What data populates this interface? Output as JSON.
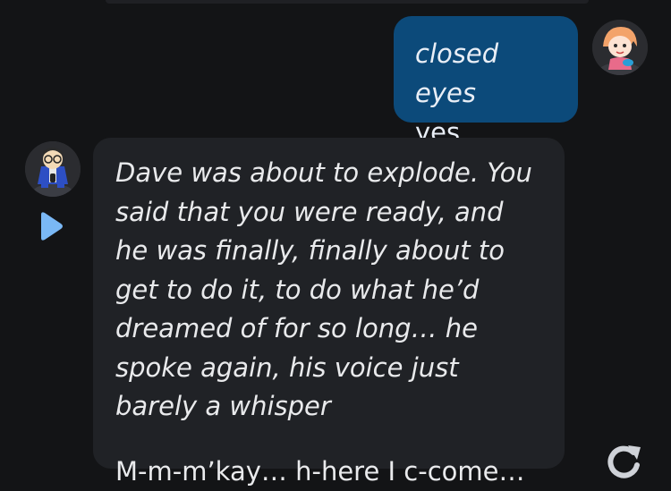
{
  "chat": {
    "user_message": {
      "line1": "closed eyes",
      "line2": "yes"
    },
    "bot_message": {
      "narration": "Dave was about to explode. You said that you were ready, and he was finally, finally about to get to do it, to do what he’d dreamed of for so long… he spoke again, his voice just barely a whisper",
      "dialogue": "M-m-m’kay… h-here I c-come…"
    }
  },
  "colors": {
    "background": "#131416",
    "user_bubble": "#0c4a7a",
    "bot_bubble": "#202226",
    "play_icon": "#7ab8f5"
  },
  "icons": {
    "play": "play-icon",
    "regenerate": "regenerate-icon",
    "user_avatar": "girlfriend-avatar",
    "bot_avatar": "dave-avatar"
  }
}
